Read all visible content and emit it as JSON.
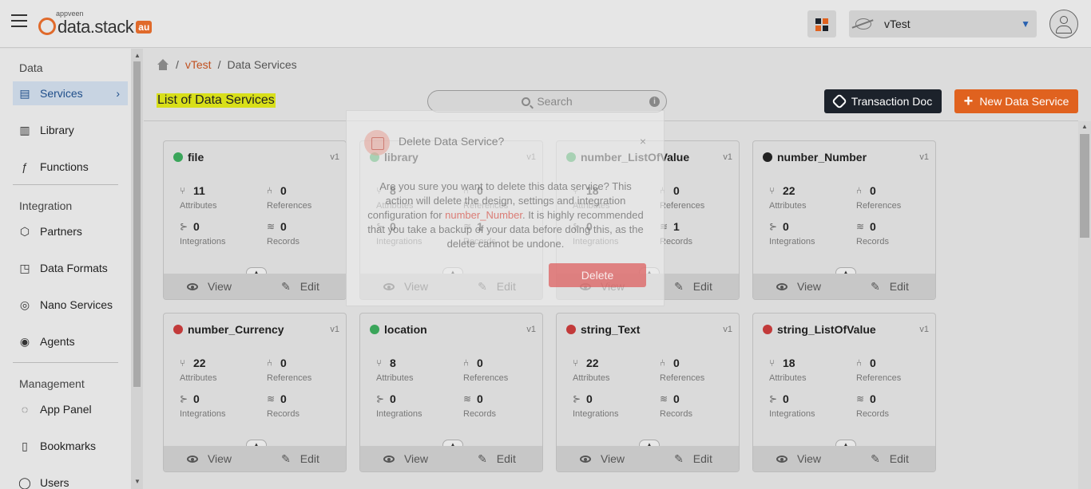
{
  "app": {
    "logo_small": "appveen",
    "logo_text": "data.stack",
    "logo_badge": "au",
    "selected_app": "vTest"
  },
  "sidebar": {
    "sections": [
      {
        "title": "Data",
        "items": [
          "Services",
          "Library",
          "Functions"
        ]
      },
      {
        "title": "Integration",
        "items": [
          "Partners",
          "Data Formats",
          "Nano Services",
          "Agents"
        ]
      },
      {
        "title": "Management",
        "items": [
          "App Panel",
          "Bookmarks",
          "Users"
        ]
      }
    ],
    "s_data": "Data",
    "s_integration": "Integration",
    "s_management": "Management",
    "services": "Services",
    "library": "Library",
    "functions": "Functions",
    "partners": "Partners",
    "data_formats": "Data Formats",
    "nano_services": "Nano Services",
    "agents": "Agents",
    "app_panel": "App Panel",
    "bookmarks": "Bookmarks",
    "users": "Users"
  },
  "breadcrumb": {
    "app": "vTest",
    "sep": "/",
    "current": "Data Services"
  },
  "page": {
    "title": "List of Data Services",
    "search_placeholder": "Search",
    "transaction_doc": "Transaction Doc",
    "new_service": "New Data Service"
  },
  "labels": {
    "attributes": "Attributes",
    "references": "References",
    "integrations": "Integrations",
    "records": "Records",
    "view": "View",
    "edit": "Edit"
  },
  "colors": {
    "green": "#3aa55a",
    "black": "#222222",
    "red": "#c23a3a",
    "accent": "#e0621f"
  },
  "cards": [
    {
      "name": "file",
      "version": "v1",
      "status": "green",
      "attributes": "11",
      "references": "0",
      "integrations": "0",
      "records": "0"
    },
    {
      "name": "library",
      "version": "v1",
      "status": "green",
      "attributes": "8",
      "references": "0",
      "integrations": "0",
      "records": "1"
    },
    {
      "name": "number_ListOfValue",
      "version": "v1",
      "status": "green",
      "attributes": "18",
      "references": "0",
      "integrations": "0",
      "records": "1"
    },
    {
      "name": "number_Number",
      "version": "v1",
      "status": "black",
      "attributes": "22",
      "references": "0",
      "integrations": "0",
      "records": "0"
    },
    {
      "name": "number_Currency",
      "version": "v1",
      "status": "red",
      "attributes": "22",
      "references": "0",
      "integrations": "0",
      "records": "0"
    },
    {
      "name": "location",
      "version": "v1",
      "status": "green",
      "attributes": "8",
      "references": "0",
      "integrations": "0",
      "records": "0"
    },
    {
      "name": "string_Text",
      "version": "v1",
      "status": "red",
      "attributes": "22",
      "references": "0",
      "integrations": "0",
      "records": "0"
    },
    {
      "name": "string_ListOfValue",
      "version": "v1",
      "status": "red",
      "attributes": "18",
      "references": "0",
      "integrations": "0",
      "records": "0"
    }
  ],
  "modal": {
    "title": "Delete Data Service?",
    "close": "×",
    "body_before": "Are you sure you want to delete this data service? This action will delete the design, settings and integration configuration for ",
    "service_name": "number_Number",
    "body_after": ". It is highly recommended that you take a backup of your data before doing this, as the delete cannot be undone.",
    "delete_label": "Delete"
  }
}
